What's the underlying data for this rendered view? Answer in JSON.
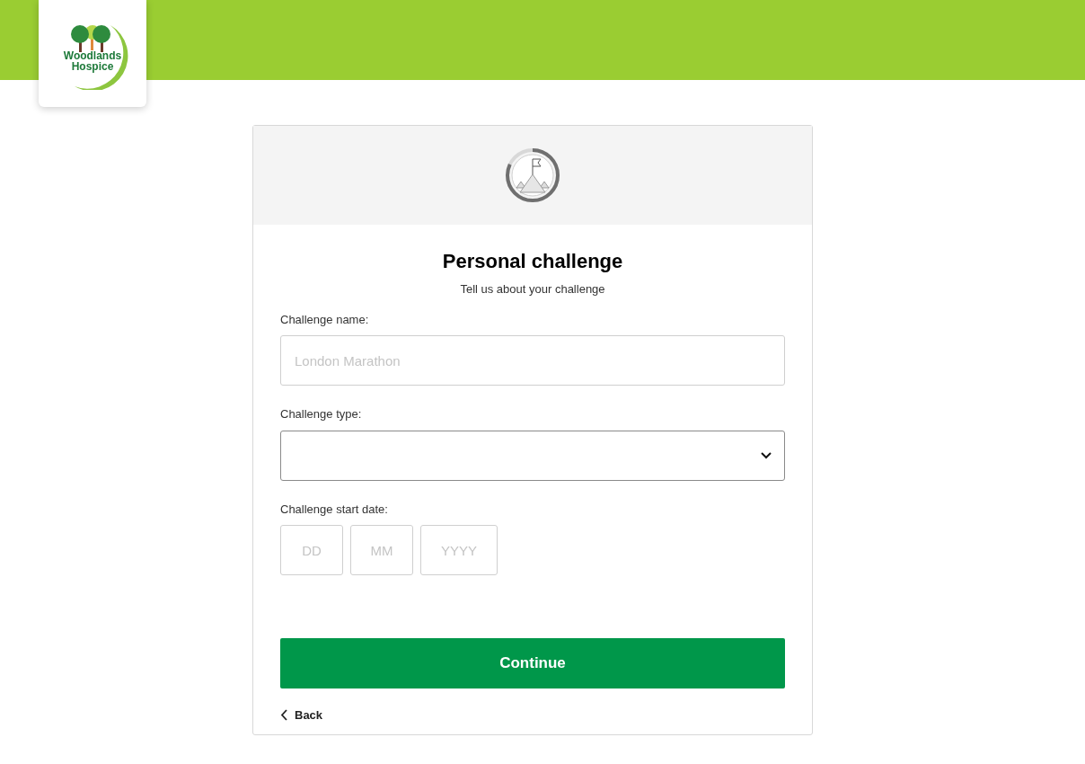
{
  "logo": {
    "line_1": "Woodlands",
    "line_2": "Hospice"
  },
  "progress": {
    "level": 0.82
  },
  "form": {
    "title": "Personal challenge",
    "subtitle": "Tell us about your challenge",
    "fields": [
      {
        "kind": "text",
        "label": "Challenge name:",
        "placeholder": "London Marathon"
      },
      {
        "kind": "select",
        "label": "Challenge type:"
      },
      {
        "kind": "date",
        "label": "Challenge start date:",
        "parts": [
          {
            "placeholder": "DD"
          },
          {
            "placeholder": "MM"
          },
          {
            "placeholder": "YYYY"
          }
        ]
      }
    ],
    "continue_button": "Continue",
    "back_link": "Back"
  }
}
